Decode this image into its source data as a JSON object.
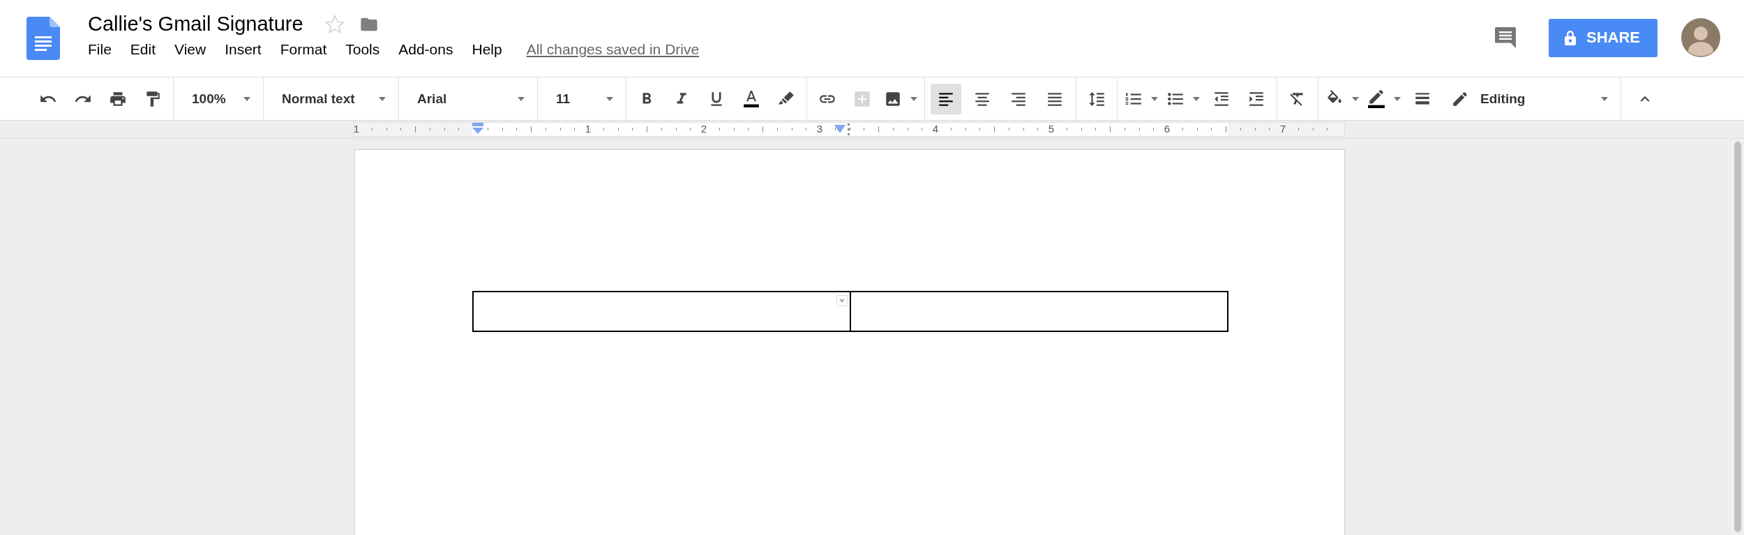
{
  "document": {
    "title": "Callie's Gmail Signature",
    "starred": false
  },
  "menu": [
    "File",
    "Edit",
    "View",
    "Insert",
    "Format",
    "Tools",
    "Add-ons",
    "Help"
  ],
  "save_status": "All changes saved in Drive",
  "share_button": {
    "label": "SHARE"
  },
  "toolbar": {
    "zoom": "100%",
    "style": "Normal text",
    "font": "Arial",
    "font_size": "11",
    "insert_comment_disabled": true,
    "alignment": [
      {
        "selected": true
      },
      {
        "selected": false
      },
      {
        "selected": false
      },
      {
        "selected": false
      }
    ],
    "mode": "Editing"
  },
  "ruler": {
    "labels": [
      "1",
      "1",
      "2",
      "3",
      "4",
      "5",
      "6",
      "7"
    ]
  }
}
